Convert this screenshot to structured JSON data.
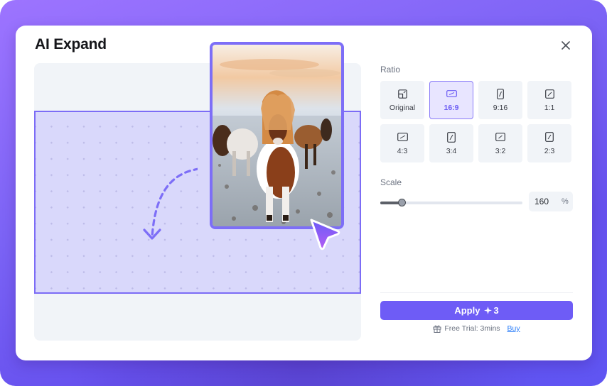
{
  "dialog": {
    "title": "AI Expand",
    "close_icon": "close-icon"
  },
  "colors": {
    "accent": "#6e5cf6",
    "expand_area": "#d9d8fb",
    "frame_border": "#7d6ef7",
    "link": "#2d7ff9"
  },
  "canvas": {
    "image_description": "Shetland pony with long ginger mane standing in snowy field, other ponies behind",
    "arrow_icon": "dashed-curved-arrow-icon",
    "cursor_icon": "pointer-cursor-icon"
  },
  "panel": {
    "ratio_label": "Ratio",
    "ratios": [
      {
        "label": "Original",
        "icon": "original-ratio-icon",
        "selected": false
      },
      {
        "label": "16:9",
        "icon": "ratio-16-9-icon",
        "selected": true
      },
      {
        "label": "9:16",
        "icon": "ratio-9-16-icon",
        "selected": false
      },
      {
        "label": "1:1",
        "icon": "ratio-1-1-icon",
        "selected": false
      },
      {
        "label": "4:3",
        "icon": "ratio-4-3-icon",
        "selected": false
      },
      {
        "label": "3:4",
        "icon": "ratio-3-4-icon",
        "selected": false
      },
      {
        "label": "3:2",
        "icon": "ratio-3-2-icon",
        "selected": false
      },
      {
        "label": "2:3",
        "icon": "ratio-2-3-icon",
        "selected": false
      }
    ],
    "scale_label": "Scale",
    "scale_value": "160",
    "scale_unit": "%",
    "scale_slider_fraction": 0.15,
    "apply_label": "Apply",
    "apply_cost": "3",
    "trial_text": "Free Trial: 3mins",
    "buy_label": "Buy"
  }
}
